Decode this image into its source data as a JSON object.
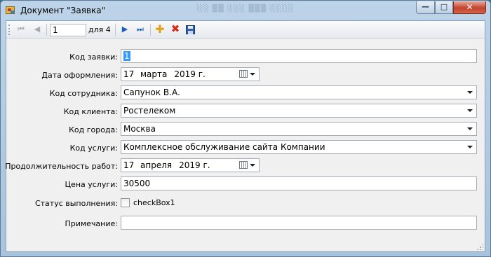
{
  "window": {
    "title": "Документ \"Заявка\"",
    "min_glyph": "—",
    "max_glyph": "□",
    "close_glyph": "✕",
    "background_text": "░░ ▒▒ ░░░ ▒▒▒ ░░░░"
  },
  "navigator": {
    "position": "1",
    "count_label": "для 4",
    "icons": {
      "first": "move-first-icon",
      "prev": "move-previous-icon",
      "next": "move-next-icon",
      "last": "move-last-icon",
      "add": "add-new-icon",
      "delete": "delete-icon",
      "save": "save-icon"
    },
    "first_glyph": "⏮",
    "prev_glyph": "◀",
    "next_glyph": "▶",
    "last_glyph": "⏭",
    "add_glyph": "✚",
    "delete_glyph": "✖"
  },
  "form": {
    "order_id": {
      "label": "Код заявки:",
      "value": "1"
    },
    "order_date": {
      "label": "Дата оформления:",
      "day": "17",
      "month": "марта",
      "year": "2019 г."
    },
    "employee": {
      "label": "Код сотрудника:",
      "value": "Сапунок В.А."
    },
    "client": {
      "label": "Код клиента:",
      "value": "Ростелеком"
    },
    "city": {
      "label": "Код города:",
      "value": "Москва"
    },
    "service": {
      "label": "Код услуги:",
      "value": "Комплексное обслуживание сайта Компании"
    },
    "duration": {
      "label": "Продолжительность работ:",
      "day": "17",
      "month": "апреля",
      "year": "2019 г."
    },
    "price": {
      "label": "Цена услуги:",
      "value": "30500"
    },
    "status": {
      "label": "Статус выполнения:",
      "checkbox_text": "checkBox1",
      "checked": false
    },
    "note": {
      "label": "Примечание:",
      "value": ""
    }
  },
  "colors": {
    "selection": "#3399ff",
    "close_button": "#c4432c",
    "nav_active": "#1b5fb5",
    "add_icon": "#e2a11a",
    "delete_icon": "#d62b1f"
  }
}
